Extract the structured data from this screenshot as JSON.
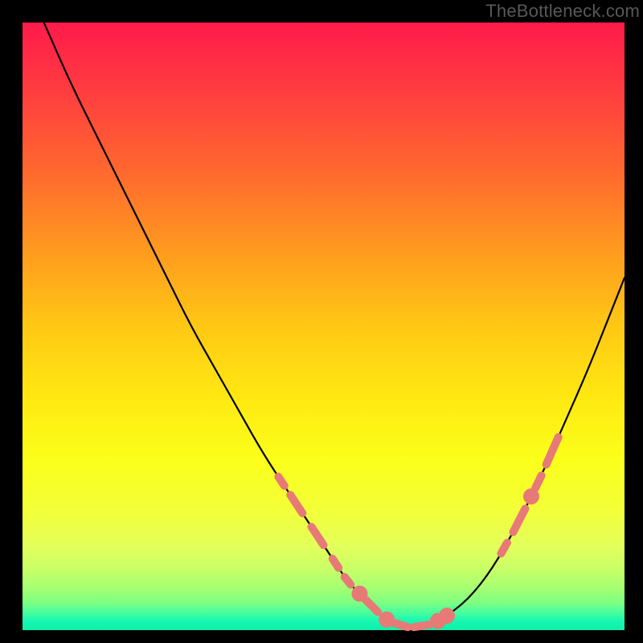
{
  "watermark": "TheBottleneck.com",
  "colors": {
    "background": "#000000",
    "curve_stroke": "#000000",
    "highlight_stroke": "#e77a77",
    "gradient_top": "#ff1a4b",
    "gradient_bottom": "#0df0a8"
  },
  "chart_data": {
    "type": "line",
    "title": "",
    "xlabel": "",
    "ylabel": "",
    "xlim": [
      0,
      100
    ],
    "ylim": [
      0,
      100
    ],
    "series": [
      {
        "name": "bottleneck-curve",
        "x": [
          0,
          4,
          8,
          12,
          16,
          20,
          24,
          28,
          32,
          36,
          40,
          44,
          48,
          52,
          54,
          56,
          58,
          60,
          62,
          64,
          66,
          68,
          70,
          74,
          78,
          82,
          86,
          90,
          94,
          98,
          100
        ],
        "y": [
          108,
          99,
          90,
          82,
          74,
          66,
          58,
          50,
          43,
          36,
          29,
          23,
          17,
          11,
          8,
          6,
          4,
          2,
          1,
          0.5,
          0.5,
          1,
          2,
          5,
          10,
          17,
          25,
          34,
          43,
          53,
          58
        ]
      }
    ],
    "highlight_segments": [
      {
        "type": "dash",
        "x0": 42.5,
        "x1": 43.5,
        "level": "left"
      },
      {
        "type": "dash",
        "x0": 44.5,
        "x1": 46.5,
        "level": "left"
      },
      {
        "type": "dash",
        "x0": 48.0,
        "x1": 50.0,
        "level": "left"
      },
      {
        "type": "dash",
        "x0": 51.5,
        "x1": 52.5,
        "level": "left"
      },
      {
        "type": "dash",
        "x0": 53.5,
        "x1": 54.5,
        "level": "left"
      },
      {
        "type": "dot",
        "x": 56.0,
        "level": "floor"
      },
      {
        "type": "dash",
        "x0": 57.0,
        "x1": 59.0,
        "level": "floor"
      },
      {
        "type": "dot",
        "x": 60.5,
        "level": "floor"
      },
      {
        "type": "dash",
        "x0": 61.5,
        "x1": 64.0,
        "level": "floor"
      },
      {
        "type": "dash",
        "x0": 65.0,
        "x1": 67.5,
        "level": "floor"
      },
      {
        "type": "dot",
        "x": 69.0,
        "level": "floor"
      },
      {
        "type": "dot",
        "x": 70.5,
        "level": "floor"
      },
      {
        "type": "dash",
        "x0": 79.5,
        "x1": 80.5,
        "level": "right"
      },
      {
        "type": "dash",
        "x0": 81.5,
        "x1": 83.5,
        "level": "right"
      },
      {
        "type": "dot",
        "x": 84.5,
        "level": "right"
      },
      {
        "type": "dash",
        "x0": 85.2,
        "x1": 86.2,
        "level": "right"
      },
      {
        "type": "dash",
        "x0": 87.0,
        "x1": 89.0,
        "level": "right"
      }
    ]
  }
}
